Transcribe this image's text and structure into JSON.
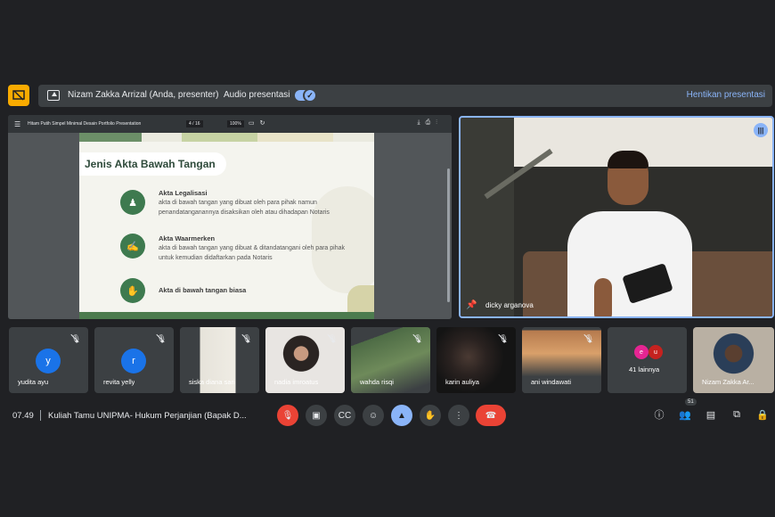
{
  "presenting_bar": {
    "presenter_text": "Nizam Zakka Arrizal (Anda, presenter)",
    "audio_label": "Audio presentasi",
    "stop_label": "Hentikan presentasi"
  },
  "pdf_viewer": {
    "menu_icon": "menu-icon",
    "title": "Hitam Putih Simpel Minimal Desain Portfolio Presentation",
    "page_indicator": "4 / 16",
    "zoom": "100%"
  },
  "slide": {
    "title": "Jenis Akta Bawah Tangan",
    "items": [
      {
        "title": "Akta Legalisasi",
        "desc": "akta di bawah tangan yang dibuat oleh para pihak namun penandatanganannya disaksikan oleh atau dihadapan Notaris"
      },
      {
        "title": "Akta Waarmerken",
        "desc": "akta di bawah tangan yang dibuat & ditandatangani oleh para pihak untuk kemudian didaftarkan pada Notaris"
      },
      {
        "title": "Akta di bawah tangan biasa",
        "desc": ""
      }
    ]
  },
  "speaker": {
    "name": "dicky arganova"
  },
  "participants": [
    {
      "name": "yudita ayu",
      "initial": "y",
      "color": "#1a73e8"
    },
    {
      "name": "revita yelly",
      "initial": "r",
      "color": "#1a73e8"
    },
    {
      "name": "siska diana sari",
      "initial": "",
      "color": ""
    },
    {
      "name": "nadia imroatus",
      "initial": "",
      "color": ""
    },
    {
      "name": "wahda risqi",
      "initial": "",
      "color": ""
    },
    {
      "name": "karin auliya",
      "initial": "",
      "color": ""
    },
    {
      "name": "ani windawati",
      "initial": "",
      "color": ""
    },
    {
      "name": "41 lainnya",
      "initial": "e",
      "initial2": "u",
      "color": "#e52592"
    },
    {
      "name": "Nizam Zakka Ar...",
      "initial": "",
      "color": ""
    }
  ],
  "bottom": {
    "time": "07.49",
    "meeting_title": "Kuliah Tamu UNIPMA- Hukum Perjanjian (Bapak D...",
    "participant_count": "51"
  },
  "colors": {
    "accent_blue": "#8ab4f8",
    "danger_red": "#ea4335",
    "present_yellow": "#f9ab00",
    "slide_green": "#3e7a4f"
  }
}
